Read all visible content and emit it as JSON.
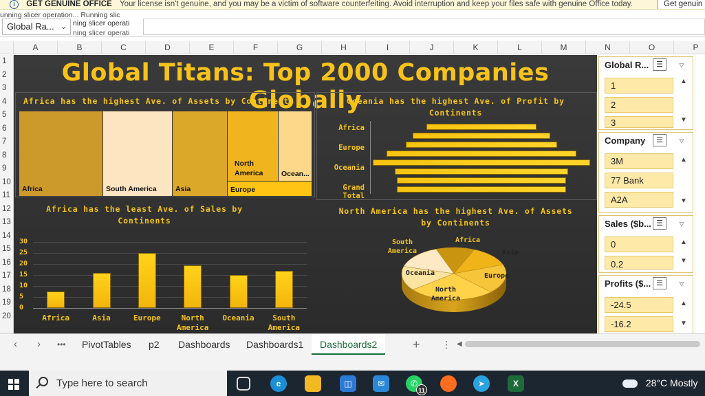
{
  "notice": {
    "title": "GET GENUINE OFFICE",
    "message": "Your license isn't genuine, and you may be a victim of software counterfeiting. Avoid interruption and keep your files safe with genuine Office today.",
    "button": "Get genuin"
  },
  "namebox": {
    "value": "Global Ra..."
  },
  "tooltip": {
    "line1": "unning slicer operation... Running slic",
    "line2": "ning slicer operati",
    "line3": "ning slicer operati"
  },
  "columns": [
    "A",
    "B",
    "C",
    "D",
    "E",
    "F",
    "G",
    "H",
    "I",
    "J",
    "K",
    "L",
    "M",
    "N",
    "O",
    "P"
  ],
  "rows": [
    "1",
    "2",
    "3",
    "4",
    "5",
    "6",
    "7",
    "8",
    "9",
    "10",
    "11",
    "12",
    "13",
    "14",
    "15",
    "16",
    "17",
    "18",
    "19",
    "20"
  ],
  "dashboard": {
    "title": "Global Titans: Top 2000 Companies Globally",
    "treemap_title": "Africa has the highest Ave. of Assets by Continents",
    "treemap_labels": [
      "Africa",
      "South America",
      "Asia",
      "North America",
      "Ocean...",
      "Europe"
    ],
    "hbar_title": "Oceania has the highest Ave. of Profit by Continents",
    "hbar_labels": [
      "Africa",
      "Europe",
      "Oceania",
      "Grand Total"
    ],
    "col_title": "Africa has the least Ave. of Sales by Continents",
    "col_axis": [
      "30",
      "25",
      "20",
      "15",
      "10",
      "5",
      "0"
    ],
    "col_labels": [
      "Africa",
      "Asia",
      "Europe",
      "North America",
      "Oceania",
      "South America"
    ],
    "pie_title": "North America has the highest Ave. of Assets by Continents",
    "pie_labels": [
      "Africa",
      "Asia",
      "Europe",
      "North America",
      "Oceania",
      "South America"
    ]
  },
  "chart_data": [
    {
      "type": "treemap",
      "title": "Africa has the highest Ave. of Assets by Continents",
      "categories": [
        "Africa",
        "South America",
        "Asia",
        "North America",
        "Oceania",
        "Europe"
      ],
      "values": [
        30,
        25,
        20,
        16,
        11,
        8
      ]
    },
    {
      "type": "bar",
      "orientation": "horizontal",
      "title": "Oceania has the highest Ave. of Profit by Continents",
      "categories": [
        "Africa",
        "",
        "Europe",
        "",
        "Oceania",
        "",
        "",
        "Grand Total"
      ],
      "values": [
        5.2,
        6.5,
        7.2,
        9.0,
        10.3,
        8.2,
        8.0,
        8.0
      ],
      "ylim": [
        0,
        10.5
      ]
    },
    {
      "type": "bar",
      "title": "Africa has the least Ave. of Sales by Continents",
      "categories": [
        "Africa",
        "Asia",
        "Europe",
        "North America",
        "Oceania",
        "South America"
      ],
      "values": [
        7.5,
        16,
        25,
        19.5,
        15,
        17
      ],
      "ylim": [
        0,
        30
      ]
    },
    {
      "type": "pie",
      "title": "North America has the highest Ave. of Assets by Continents",
      "categories": [
        "Africa",
        "Asia",
        "Europe",
        "North America",
        "Oceania",
        "South America"
      ],
      "values": [
        12,
        13,
        18,
        27,
        15,
        15
      ]
    }
  ],
  "slicers": [
    {
      "header": "Global R...",
      "items": [
        "1",
        "2",
        "3"
      ]
    },
    {
      "header": "Company",
      "items": [
        "3M",
        "77 Bank",
        "A2A"
      ]
    },
    {
      "header": "Sales ($b...",
      "items": [
        "0",
        "0.2"
      ]
    },
    {
      "header": "Profits ($...",
      "items": [
        "-24.5",
        "-16.2"
      ]
    }
  ],
  "sheet_tabs": [
    "PivotTables",
    "p2",
    "Dashboards",
    "Dashboards1",
    "Dashboards2"
  ],
  "active_tab": "Dashboards2",
  "taskbar": {
    "search_placeholder": "Type here to search",
    "whatsapp_badge": "11",
    "weather": "28°C  Mostly"
  },
  "colors": {
    "accent": "#f5c518",
    "dashboard_bg": "#333333",
    "excel_green": "#1d6b3a"
  }
}
